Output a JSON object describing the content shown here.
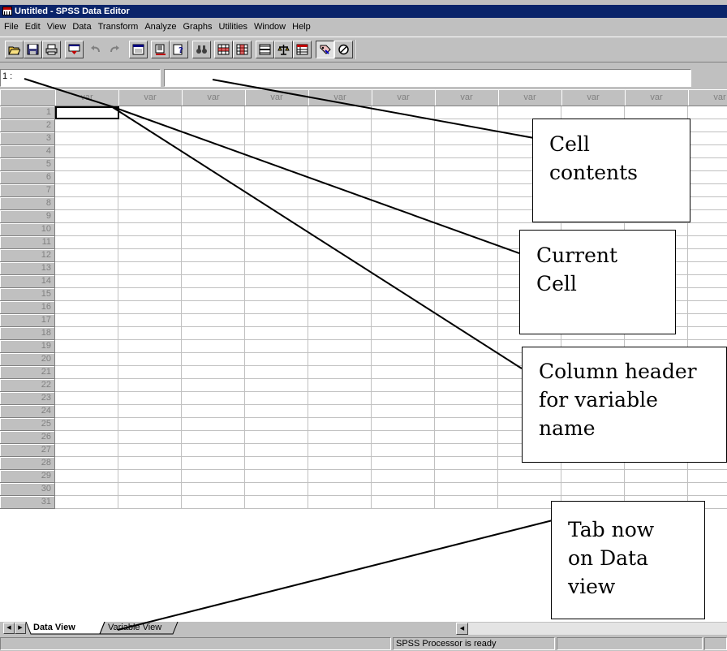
{
  "window": {
    "title": "Untitled - SPSS Data Editor"
  },
  "menu": [
    "File",
    "Edit",
    "View",
    "Data",
    "Transform",
    "Analyze",
    "Graphs",
    "Utilities",
    "Window",
    "Help"
  ],
  "toolbar": {
    "buttons": [
      "open-file",
      "save",
      "print",
      "dialog-recall",
      "undo",
      "redo",
      "goto-chart",
      "goto-case",
      "variables",
      "find",
      "insert-case",
      "insert-variable",
      "split-file",
      "weight-cases",
      "select-cases",
      "value-labels",
      "use-sets"
    ]
  },
  "editor": {
    "cell_ref": "1 :",
    "cell_value": ""
  },
  "grid": {
    "column_headers": [
      "var",
      "var",
      "var",
      "var",
      "var",
      "var",
      "var",
      "var",
      "var",
      "var",
      "var"
    ],
    "row_numbers": [
      "1",
      "2",
      "3",
      "4",
      "5",
      "6",
      "7",
      "8",
      "9",
      "10",
      "11",
      "12",
      "13",
      "14",
      "15",
      "16",
      "17",
      "18",
      "19",
      "20",
      "21",
      "22",
      "23",
      "24",
      "25",
      "26",
      "27",
      "28",
      "29",
      "30",
      "31"
    ]
  },
  "tabs": {
    "data_view": "Data View",
    "variable_view": "Variable View"
  },
  "status": {
    "processor": "SPSS Processor  is ready"
  },
  "callouts": {
    "cell_contents": [
      "Cell",
      "contents"
    ],
    "current_cell": [
      "Current",
      "Cell"
    ],
    "column_header": [
      "Column header",
      "for variable",
      "name"
    ],
    "tab_data_view": [
      "Tab now",
      "on Data",
      "view"
    ]
  },
  "colors": {
    "titlebar": "#0a246a",
    "window_face": "#c0c0c0",
    "grid_line": "#c0c0c0",
    "header_text": "#808080"
  }
}
